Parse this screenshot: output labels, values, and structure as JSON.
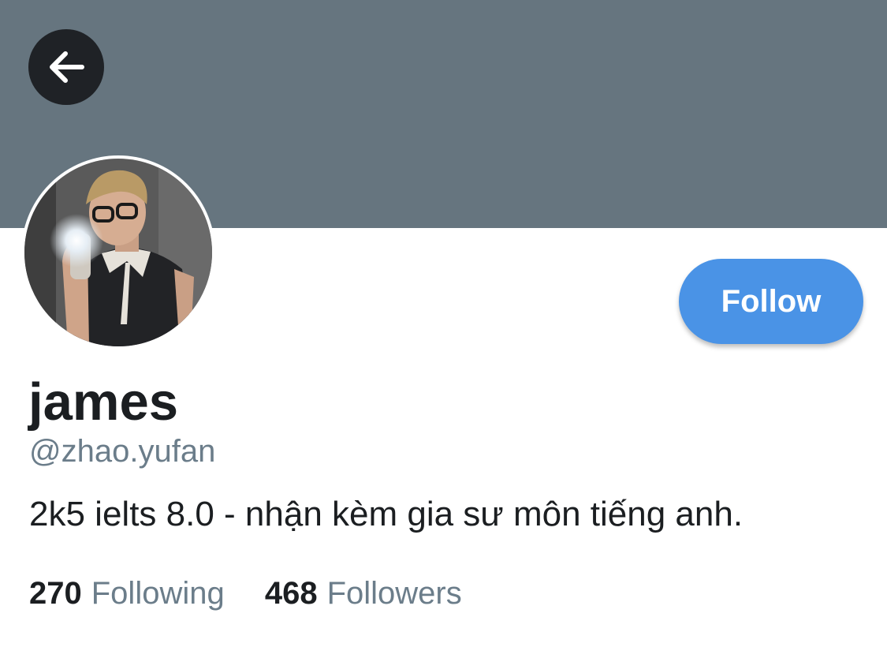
{
  "colors": {
    "banner": "#66757f",
    "back_button": "#1f2226",
    "follow_button": "#4a93e6",
    "primary_text": "#1b1e21",
    "secondary_text": "#6b7d8a"
  },
  "header": {
    "back_icon": "arrow-left-icon"
  },
  "profile": {
    "avatar_icon": "avatar-photo",
    "display_name": "james",
    "handle": "@zhao.yufan",
    "bio": "2k5 ielts 8.0 - nhận kèm gia sư môn tiếng anh.",
    "follow_label": "Follow"
  },
  "stats": {
    "following": {
      "count": "270",
      "label": "Following"
    },
    "followers": {
      "count": "468",
      "label": "Followers"
    }
  }
}
